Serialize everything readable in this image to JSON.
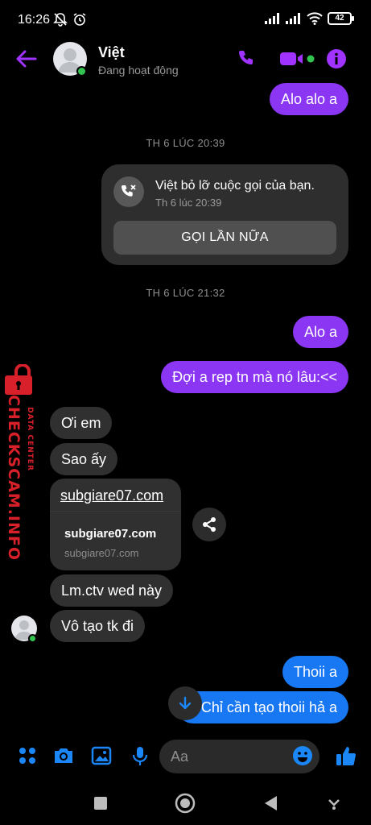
{
  "status_bar": {
    "time": "16:26",
    "battery": "42"
  },
  "header": {
    "contact_name": "Việt",
    "contact_status": "Đang hoạt động",
    "accent_color": "#a033ff"
  },
  "messages": {
    "top_sent": "Alo alo a",
    "timestamp_1": "TH 6 LÚC 20:39",
    "missed_call": {
      "title": "Việt bỏ lỡ cuộc gọi của bạn.",
      "subtitle": "Th 6 lúc 20:39",
      "button": "GỌI LẦN NỮA"
    },
    "timestamp_2": "TH 6 LÚC 21:32",
    "sent_1": "Alo a",
    "sent_2": "Đợi a rep tn mà nó lâu:<<",
    "recv_1": "Ơi em",
    "recv_2": "Sao ấy",
    "link": {
      "url": "subgiare07.com",
      "title": "subgiare07.com",
      "domain": "subgiare07.com"
    },
    "recv_3": "Lm.ctv wed này",
    "recv_4": "Vô tạo tk đi",
    "sent_3": "Thoii a",
    "sent_4": "Chỉ cần tạo thoii hả a"
  },
  "composer": {
    "placeholder": "Aa"
  },
  "watermark": {
    "main": "CHECKSCAM.INFO",
    "sub": "DATA CENTER"
  },
  "colors": {
    "sent_purple": "#8a36f3",
    "sent_blue": "#1877f2",
    "received": "#303030",
    "icon_blue": "#1b86f5"
  }
}
